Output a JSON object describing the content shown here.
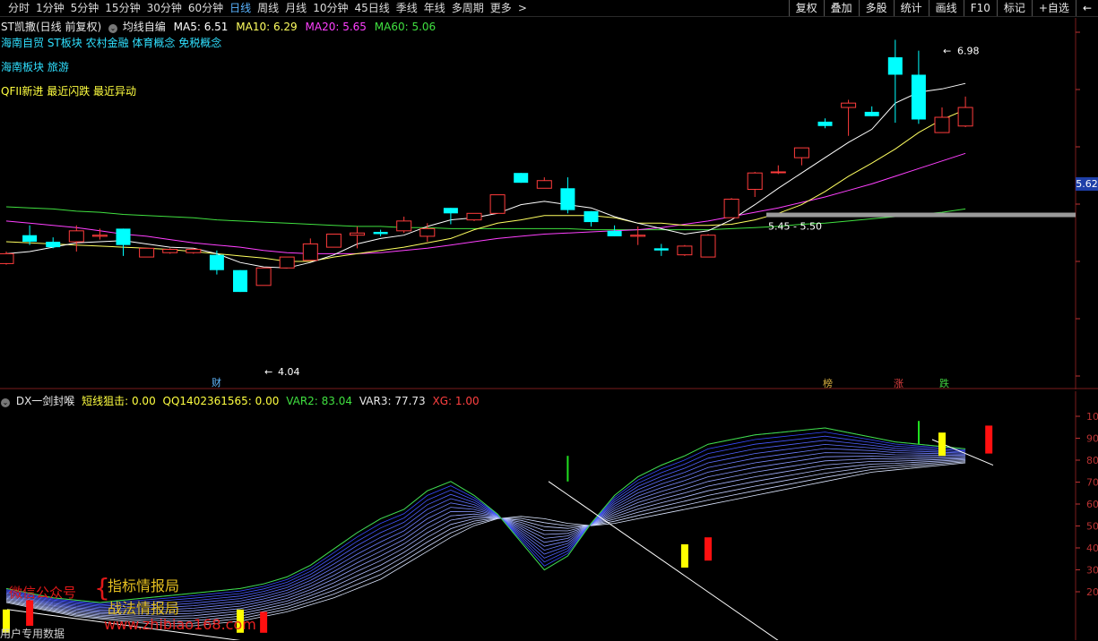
{
  "toolbar": {
    "periods": [
      "分时",
      "1分钟",
      "5分钟",
      "15分钟",
      "30分钟",
      "60分钟",
      "日线",
      "周线",
      "月线",
      "10分钟",
      "45日线",
      "季线",
      "年线",
      "多周期",
      "更多"
    ],
    "active_period": "日线",
    "more_arrow": ">",
    "tools": [
      "复权",
      "叠加",
      "多股",
      "统计",
      "画线",
      "F10",
      "标记",
      "+自选"
    ],
    "back_icon": "back-arrow-icon"
  },
  "header": {
    "stock": "ST凯撒(日线 前复权)",
    "indicator_name": "均线自编",
    "ma5": "MA5: 6.51",
    "ma10": "MA10: 6.29",
    "ma20": "MA20: 5.65",
    "ma60": "MA60: 5.06"
  },
  "concepts": {
    "line1": "海南自贸 ST板块 农村金融 体育概念 免税概念",
    "line2": "海南板块 旅游",
    "line3": "QFII新进 最近闪跌 最近异动"
  },
  "price_labels": {
    "high": "6.98",
    "low": "4.04",
    "range": "5.45 - 5.50",
    "current": "5.62"
  },
  "events": [
    {
      "text": "财",
      "color": "#60b8ff"
    },
    {
      "text": "榜",
      "color": "#d8b040"
    },
    {
      "text": "涨",
      "color": "#e04040"
    },
    {
      "text": "跌",
      "color": "#40d040"
    }
  ],
  "sub_header": {
    "name": "DX一剑封喉",
    "l1": "短线狙击: 0.00",
    "l2": "QQ1402361565: 0.00",
    "l3": "VAR2: 83.04",
    "l4": "VAR3: 77.73",
    "l5": "XG: 1.00"
  },
  "sub_axis": [
    "10",
    "90",
    "80",
    "70",
    "60",
    "50",
    "40",
    "30",
    "20"
  ],
  "watermark": {
    "wechat": "微信公众号",
    "brace": "{",
    "line1": "指标情报局",
    "line2": "战法情报局",
    "site": "www.zhibiao168.com",
    "footer": "用户专用数据"
  },
  "colors": {
    "up": "#ff3c3c",
    "down": "#00ffff",
    "ma5": "#ffffff",
    "ma10": "#ffff60",
    "ma20": "#ff40ff",
    "ma60": "#40e040"
  },
  "chart_data": {
    "type": "candlestick",
    "candles": [
      {
        "o": 5.03,
        "c": 5.12,
        "h": 5.14,
        "l": 5.02
      },
      {
        "o": 5.29,
        "c": 5.23,
        "h": 5.38,
        "l": 5.2
      },
      {
        "o": 5.23,
        "c": 5.18,
        "h": 5.27,
        "l": 5.17
      },
      {
        "o": 5.23,
        "c": 5.33,
        "h": 5.38,
        "l": 5.14
      },
      {
        "o": 5.28,
        "c": 5.29,
        "h": 5.35,
        "l": 5.25
      },
      {
        "o": 5.35,
        "c": 5.2,
        "h": 5.35,
        "l": 5.1
      },
      {
        "o": 5.09,
        "c": 5.17,
        "h": 5.17,
        "l": 5.09
      },
      {
        "o": 5.13,
        "c": 5.16,
        "h": 5.17,
        "l": 5.12
      },
      {
        "o": 5.13,
        "c": 5.16,
        "h": 5.17,
        "l": 5.12
      },
      {
        "o": 5.11,
        "c": 4.97,
        "h": 5.15,
        "l": 4.93
      },
      {
        "o": 4.97,
        "c": 4.77,
        "h": 4.97,
        "l": 4.77
      },
      {
        "o": 4.83,
        "c": 4.99,
        "h": 4.99,
        "l": 4.83
      },
      {
        "o": 4.99,
        "c": 5.09,
        "h": 5.09,
        "l": 4.99
      },
      {
        "o": 5.06,
        "c": 5.21,
        "h": 5.26,
        "l": 5.06
      },
      {
        "o": 5.18,
        "c": 5.3,
        "h": 5.3,
        "l": 5.18
      },
      {
        "o": 5.29,
        "c": 5.31,
        "h": 5.37,
        "l": 5.17
      },
      {
        "o": 5.32,
        "c": 5.3,
        "h": 5.34,
        "l": 5.28
      },
      {
        "o": 5.33,
        "c": 5.42,
        "h": 5.46,
        "l": 5.31
      },
      {
        "o": 5.28,
        "c": 5.35,
        "h": 5.4,
        "l": 5.23
      },
      {
        "o": 5.54,
        "c": 5.49,
        "h": 5.54,
        "l": 5.39
      },
      {
        "o": 5.43,
        "c": 5.49,
        "h": 5.49,
        "l": 5.42
      },
      {
        "o": 5.49,
        "c": 5.66,
        "h": 5.66,
        "l": 5.49
      },
      {
        "o": 5.86,
        "c": 5.77,
        "h": 5.86,
        "l": 5.77
      },
      {
        "o": 5.72,
        "c": 5.79,
        "h": 5.82,
        "l": 5.72
      },
      {
        "o": 5.72,
        "c": 5.52,
        "h": 5.82,
        "l": 5.49
      },
      {
        "o": 5.51,
        "c": 5.41,
        "h": 5.51,
        "l": 5.37
      },
      {
        "o": 5.33,
        "c": 5.28,
        "h": 5.38,
        "l": 5.28
      },
      {
        "o": 5.28,
        "c": 5.29,
        "h": 5.37,
        "l": 5.2
      },
      {
        "o": 5.17,
        "c": 5.15,
        "h": 5.21,
        "l": 5.1
      },
      {
        "o": 5.11,
        "c": 5.19,
        "h": 5.2,
        "l": 5.1
      },
      {
        "o": 5.09,
        "c": 5.29,
        "h": 5.3,
        "l": 5.09
      },
      {
        "o": 5.45,
        "c": 5.62,
        "h": 5.63,
        "l": 5.45
      },
      {
        "o": 5.71,
        "c": 5.86,
        "h": 5.87,
        "l": 5.64
      },
      {
        "o": 5.87,
        "c": 5.87,
        "h": 5.93,
        "l": 5.85
      },
      {
        "o": 6.0,
        "c": 6.09,
        "h": 6.09,
        "l": 5.93
      },
      {
        "o": 6.33,
        "c": 6.29,
        "h": 6.36,
        "l": 6.27
      },
      {
        "o": 6.46,
        "c": 6.5,
        "h": 6.53,
        "l": 6.2
      },
      {
        "o": 6.42,
        "c": 6.38,
        "h": 6.47,
        "l": 6.38
      },
      {
        "o": 6.92,
        "c": 6.76,
        "h": 7.08,
        "l": 6.32
      },
      {
        "o": 6.76,
        "c": 6.35,
        "h": 6.98,
        "l": 6.31
      },
      {
        "o": 6.23,
        "c": 6.37,
        "h": 6.46,
        "l": 6.23
      },
      {
        "o": 6.29,
        "c": 6.46,
        "h": 6.56,
        "l": 6.28
      }
    ],
    "ma5": [
      5.12,
      5.14,
      5.18,
      5.22,
      5.23,
      5.24,
      5.21,
      5.18,
      5.17,
      5.12,
      5.04,
      5.0,
      4.99,
      5.04,
      5.11,
      5.21,
      5.26,
      5.29,
      5.37,
      5.43,
      5.45,
      5.49,
      5.57,
      5.6,
      5.57,
      5.54,
      5.46,
      5.4,
      5.35,
      5.3,
      5.33,
      5.43,
      5.57,
      5.72,
      5.86,
      6.0,
      6.14,
      6.26,
      6.5,
      6.6,
      6.63,
      6.68
    ],
    "ma10": [
      5.23,
      5.22,
      5.21,
      5.2,
      5.19,
      5.18,
      5.17,
      5.16,
      5.14,
      5.12,
      5.1,
      5.08,
      5.05,
      5.05,
      5.09,
      5.12,
      5.15,
      5.18,
      5.22,
      5.26,
      5.34,
      5.4,
      5.43,
      5.47,
      5.47,
      5.47,
      5.45,
      5.4,
      5.4,
      5.38,
      5.38,
      5.39,
      5.43,
      5.49,
      5.57,
      5.69,
      5.83,
      5.95,
      6.08,
      6.23,
      6.35,
      6.44
    ],
    "ma20": [
      5.42,
      5.4,
      5.38,
      5.36,
      5.33,
      5.3,
      5.28,
      5.25,
      5.22,
      5.2,
      5.18,
      5.15,
      5.13,
      5.12,
      5.12,
      5.12,
      5.13,
      5.15,
      5.17,
      5.2,
      5.23,
      5.26,
      5.28,
      5.3,
      5.31,
      5.32,
      5.33,
      5.34,
      5.36,
      5.39,
      5.42,
      5.46,
      5.5,
      5.54,
      5.59,
      5.64,
      5.7,
      5.76,
      5.83,
      5.9,
      5.97,
      6.04
    ],
    "ma60": [
      5.55,
      5.54,
      5.53,
      5.51,
      5.5,
      5.48,
      5.47,
      5.46,
      5.45,
      5.43,
      5.42,
      5.41,
      5.4,
      5.39,
      5.38,
      5.37,
      5.37,
      5.36,
      5.36,
      5.35,
      5.35,
      5.35,
      5.35,
      5.35,
      5.35,
      5.34,
      5.34,
      5.34,
      5.34,
      5.34,
      5.34,
      5.35,
      5.36,
      5.37,
      5.39,
      5.4,
      5.42,
      5.44,
      5.46,
      5.48,
      5.5,
      5.53
    ],
    "sub_fan_top": [
      26,
      24,
      22,
      21,
      20,
      21,
      22,
      23,
      24,
      25,
      26,
      28,
      31,
      36,
      43,
      50,
      56,
      60,
      68,
      72,
      66,
      58,
      46,
      34,
      40,
      54,
      66,
      74,
      79,
      83,
      88,
      90,
      92,
      93,
      94,
      95,
      93,
      91,
      89,
      88,
      87,
      86
    ],
    "sub_fan_bottom": [
      20,
      18,
      16,
      14,
      13,
      12,
      11,
      10,
      10,
      11,
      12,
      14,
      16,
      19,
      22,
      26,
      30,
      36,
      42,
      48,
      53,
      56,
      57,
      56,
      54,
      53,
      54,
      56,
      58,
      60,
      62,
      64,
      66,
      68,
      70,
      72,
      74,
      76,
      77,
      78,
      79,
      80
    ],
    "sub_ylim": [
      10,
      100
    ]
  }
}
